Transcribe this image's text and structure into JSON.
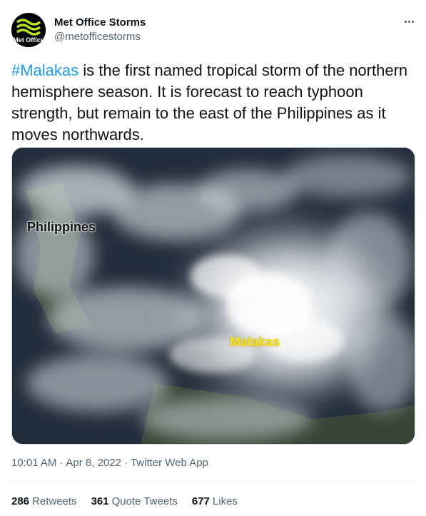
{
  "author": {
    "name": "Met Office Storms",
    "handle": "@metofficestorms",
    "avatar_text": "Met Office"
  },
  "tweet": {
    "hashtag": "#Malakas",
    "body": " is the first named tropical storm of the northern hemisphere season. It is forecast to reach typhoon strength, but remain to the east of the Philippines as it moves northwards."
  },
  "media": {
    "label_philippines": "Philippines",
    "label_malakas": "Malakas"
  },
  "meta": {
    "time": "10:01 AM",
    "sep1": "·",
    "date": "Apr 8, 2022",
    "sep2": "·",
    "app": "Twitter Web App"
  },
  "stats": {
    "retweets_count": "286",
    "retweets_label": "Retweets",
    "quotes_count": "361",
    "quotes_label": "Quote Tweets",
    "likes_count": "677",
    "likes_label": "Likes"
  },
  "colors": {
    "accent": "#1d9bf0",
    "muted": "#536471",
    "text": "#0f1419",
    "storm_label": "#f5e21b"
  },
  "icons": [
    "more-options-icon",
    "met-office-logo-icon"
  ]
}
